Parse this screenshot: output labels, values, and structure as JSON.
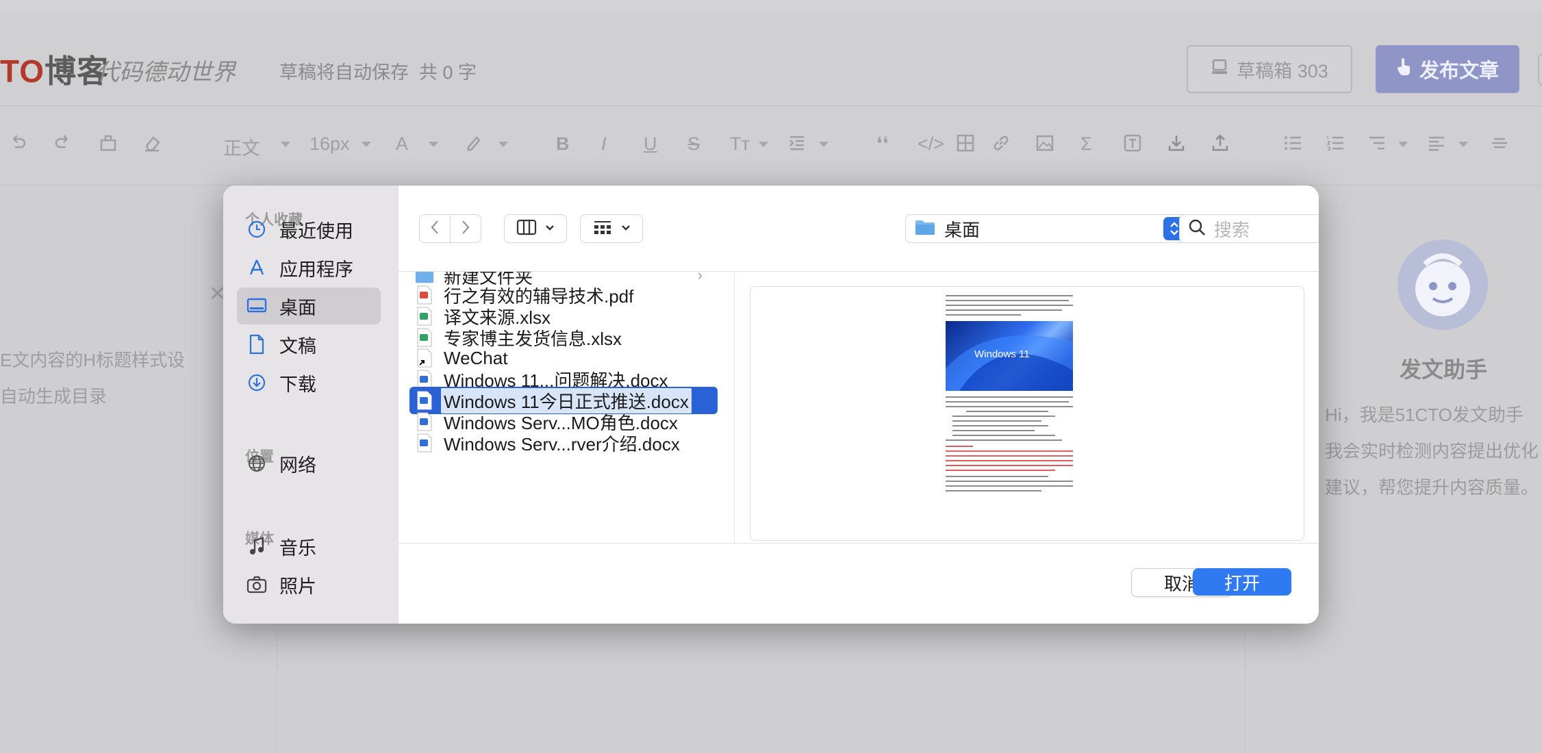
{
  "app": {
    "logo_prefix": "TO",
    "logo_main": "博客",
    "slogan": "代码德动世界",
    "autosave_text": "草稿将自动保存",
    "word_count": "共 0 字",
    "drafts_label": "草稿箱 303",
    "publish_label": "发布文章"
  },
  "toolbar": {
    "paragraph_style": "正文",
    "font_size": "16px",
    "font_color_icon": "A"
  },
  "editor": {
    "guide_lines": [
      "E文内容的H标题样式设",
      "自动生成目录"
    ],
    "helper_title": "发文助手",
    "helper_lines": [
      "Hi，我是51CTO发文助手",
      "我会实时检测内容提出优化",
      "建议，帮您提升内容质量。"
    ]
  },
  "dialog": {
    "sidebar": {
      "sections": {
        "favorites": "个人收藏",
        "locations": "位置",
        "media": "媒体"
      },
      "favorites": [
        {
          "label": "最近使用",
          "icon": "clock-icon"
        },
        {
          "label": "应用程序",
          "icon": "apps-icon"
        },
        {
          "label": "桌面",
          "icon": "desktop-icon",
          "active": true
        },
        {
          "label": "文稿",
          "icon": "document-icon"
        },
        {
          "label": "下载",
          "icon": "download-icon"
        }
      ],
      "locations": [
        {
          "label": "网络",
          "icon": "network-icon"
        }
      ],
      "media": [
        {
          "label": "音乐",
          "icon": "music-icon"
        },
        {
          "label": "照片",
          "icon": "camera-icon"
        }
      ]
    },
    "location": "桌面",
    "search_placeholder": "搜索",
    "files": [
      {
        "name": "新建文件夹",
        "type": "folder"
      },
      {
        "name": "行之有效的辅导技术.pdf",
        "type": "pdf"
      },
      {
        "name": "译文来源.xlsx",
        "type": "xlsx"
      },
      {
        "name": "专家博主发货信息.xlsx",
        "type": "xlsx"
      },
      {
        "name": "WeChat",
        "type": "alias"
      },
      {
        "name": "Windows 11...问题解决.docx",
        "type": "docx"
      },
      {
        "name": "Windows 11今日正式推送.docx",
        "type": "docx",
        "selected": true
      },
      {
        "name": "Windows Serv...MO角色.docx",
        "type": "docx"
      },
      {
        "name": "Windows Serv...rver介绍.docx",
        "type": "docx"
      }
    ],
    "preview_image_text": "Windows 11",
    "cancel_label": "取消",
    "open_label": "打开",
    "colors": {
      "accent": "#2f7af0",
      "selection": "#2a62d6"
    }
  }
}
